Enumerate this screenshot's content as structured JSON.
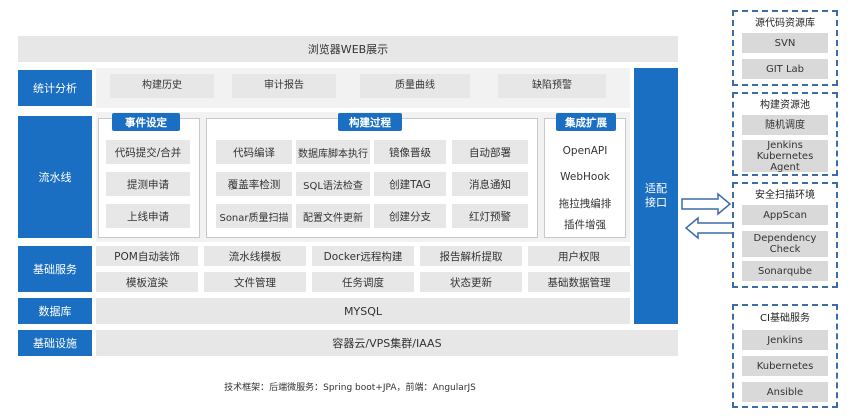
{
  "top_bar": "浏览器WEB展示",
  "rows": {
    "stats": {
      "label": "统计分析",
      "items": [
        "构建历史",
        "审计报告",
        "质量曲线",
        "缺陷预警"
      ]
    },
    "pipeline": {
      "label": "流水线",
      "event": {
        "title": "事件设定",
        "items": [
          "代码提交/合并",
          "提测申请",
          "上线申请"
        ]
      },
      "build": {
        "title": "构建过程",
        "items": [
          [
            "代码编译",
            "数据库脚本执行",
            "镜像晋级",
            "自动部署"
          ],
          [
            "覆盖率检测",
            "SQL语法检查",
            "创建TAG",
            "消息通知"
          ],
          [
            "Sonar质量扫描",
            "配置文件更新",
            "创建分支",
            "红灯预警"
          ]
        ]
      },
      "ext": {
        "title": "集成扩展",
        "items": [
          "OpenAPI",
          "WebHook",
          "拖拉拽编排",
          "插件增强"
        ]
      }
    },
    "base": {
      "label": "基础服务",
      "row1": [
        "POM自动装饰",
        "流水线模板",
        "Docker远程构建",
        "报告解析提取",
        "用户权限"
      ],
      "row2": [
        "模板渲染",
        "文件管理",
        "任务调度",
        "状态更新",
        "基础数据管理"
      ]
    },
    "db": {
      "label": "数据库",
      "value": "MYSQL"
    },
    "infra": {
      "label": "基础设施",
      "value": "容器云/VPS集群/IAAS"
    }
  },
  "adapter": "适配接口",
  "footer": "技术框架：后端微服务：Spring boot+JPA，前端：AngularJS",
  "right_groups": [
    {
      "title": "源代码资源库",
      "items": [
        "SVN",
        "GIT Lab"
      ]
    },
    {
      "title": "构建资源池",
      "items": [
        "随机调度",
        "Jenkins Kubernetes Agent"
      ]
    },
    {
      "title": "安全扫描环境",
      "items": [
        "AppScan",
        "Dependency Check",
        "Sonarqube"
      ]
    },
    {
      "title": "CI基础服务",
      "items": [
        "Jenkins",
        "Kubernetes",
        "Ansible"
      ]
    }
  ],
  "colors": {
    "blue": "#1b6fc2",
    "gray": "#e7e7e7",
    "dash": "#3b6da8"
  }
}
